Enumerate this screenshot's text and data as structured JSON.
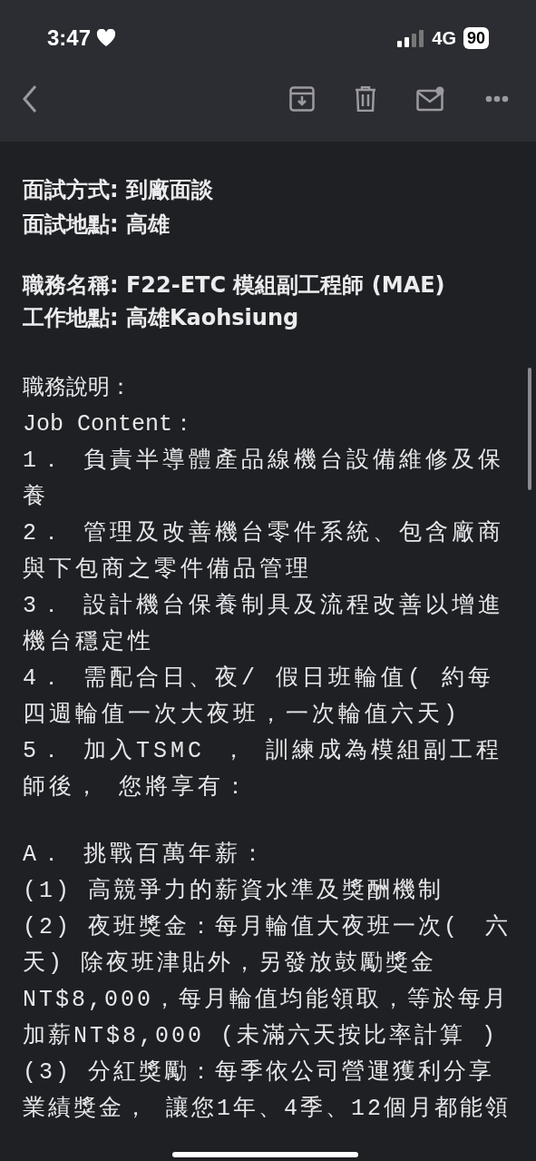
{
  "status_bar": {
    "time": "3:47",
    "network": "4G",
    "battery": "90"
  },
  "body": {
    "interview": [
      "面試方式: 到廠面談",
      "面試地點: 高雄"
    ],
    "position": [
      "職務名稱: F22-ETC 模組副工程師 (MAE)",
      "工作地點: 高雄Kaohsiung"
    ],
    "description_heading": "職務說明：",
    "job_content_heading": "Job Content：",
    "duties": [
      "1． 負責半導體產品線機台設備維修及保養",
      "2． 管理及改善機台零件系統、包含廠商與下包商之零件備品管理",
      "3． 設計機台保養制具及流程改善以增進機台穩定性",
      "4． 需配合日、夜/ 假日班輪值( 約每四週輪值一次大夜班，一次輪值六天)",
      "5． 加入TSMC ， 訓練成為模組副工程師後， 您將享有："
    ],
    "benefits_heading": "A． 挑戰百萬年薪：",
    "benefits": [
      "(1) 高競爭力的薪資水準及獎酬機制",
      "(2) 夜班獎金：每月輪值大夜班一次(　六天) 除夜班津貼外，另發放鼓勵獎金NT$8,000，每月輪值均能領取，等於每月加薪NT$8,000 (未滿六天按比率計算 )",
      "(3) 分紅獎勵：每季依公司營運獲利分享業績獎金， 讓您1年、4季、12個月都能領"
    ]
  }
}
